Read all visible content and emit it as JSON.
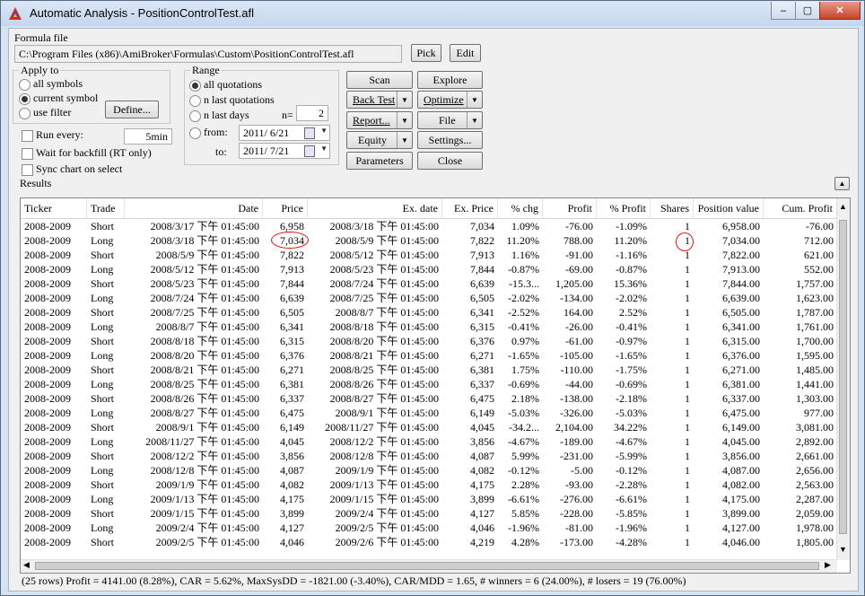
{
  "window": {
    "title": "Automatic Analysis - PositionControlTest.afl",
    "minimize": "–",
    "restore": "▢",
    "close": "✕"
  },
  "formula": {
    "label": "Formula file",
    "path": "C:\\Program Files (x86)\\AmiBroker\\Formulas\\Custom\\PositionControlTest.afl",
    "pick": "Pick",
    "edit": "Edit"
  },
  "apply_to": {
    "label": "Apply to",
    "options": [
      "all symbols",
      "current symbol",
      "use filter"
    ],
    "selected": "current symbol",
    "define": "Define..."
  },
  "range": {
    "label": "Range",
    "options": [
      "all quotations",
      "n last quotations",
      "n last days"
    ],
    "selected": "all quotations",
    "n_label": "n=",
    "n_value": "2",
    "from_label": "from:",
    "from_value": "2011/ 6/21",
    "to_label": "to:",
    "to_value": "2011/ 7/21"
  },
  "options": {
    "run_every": "Run every:",
    "run_every_value": "5min",
    "wait_backfill": "Wait for backfill (RT only)",
    "sync_chart": "Sync chart on select"
  },
  "actions": {
    "scan": "Scan",
    "explore": "Explore",
    "backtest": "Back Test",
    "optimize": "Optimize",
    "report": "Report...",
    "file": "File",
    "equity": "Equity",
    "settings": "Settings...",
    "parameters": "Parameters",
    "close": "Close"
  },
  "results": {
    "label": "Results",
    "collapse": "▲",
    "columns": [
      "Ticker",
      "Trade",
      "Date",
      "Price",
      "Ex. date",
      "Ex. Price",
      "% chg",
      "Profit",
      "% Profit",
      "Shares",
      "Position value",
      "Cum. Profit"
    ],
    "rows": [
      [
        "2008-2009",
        "Short",
        "2008/3/17 下午 01:45:00",
        "6,958",
        "2008/3/18 下午 01:45:00",
        "7,034",
        "1.09%",
        "-76.00",
        "-1.09%",
        "1",
        "6,958.00",
        "-76.00"
      ],
      [
        "2008-2009",
        "Long",
        "2008/3/18 下午 01:45:00",
        "7,034",
        "2008/5/9 下午 01:45:00",
        "7,822",
        "11.20%",
        "788.00",
        "11.20%",
        "1",
        "7,034.00",
        "712.00"
      ],
      [
        "2008-2009",
        "Short",
        "2008/5/9 下午 01:45:00",
        "7,822",
        "2008/5/12 下午 01:45:00",
        "7,913",
        "1.16%",
        "-91.00",
        "-1.16%",
        "1",
        "7,822.00",
        "621.00"
      ],
      [
        "2008-2009",
        "Long",
        "2008/5/12 下午 01:45:00",
        "7,913",
        "2008/5/23 下午 01:45:00",
        "7,844",
        "-0.87%",
        "-69.00",
        "-0.87%",
        "1",
        "7,913.00",
        "552.00"
      ],
      [
        "2008-2009",
        "Short",
        "2008/5/23 下午 01:45:00",
        "7,844",
        "2008/7/24 下午 01:45:00",
        "6,639",
        "-15.3...",
        "1,205.00",
        "15.36%",
        "1",
        "7,844.00",
        "1,757.00"
      ],
      [
        "2008-2009",
        "Long",
        "2008/7/24 下午 01:45:00",
        "6,639",
        "2008/7/25 下午 01:45:00",
        "6,505",
        "-2.02%",
        "-134.00",
        "-2.02%",
        "1",
        "6,639.00",
        "1,623.00"
      ],
      [
        "2008-2009",
        "Short",
        "2008/7/25 下午 01:45:00",
        "6,505",
        "2008/8/7 下午 01:45:00",
        "6,341",
        "-2.52%",
        "164.00",
        "2.52%",
        "1",
        "6,505.00",
        "1,787.00"
      ],
      [
        "2008-2009",
        "Long",
        "2008/8/7 下午 01:45:00",
        "6,341",
        "2008/8/18 下午 01:45:00",
        "6,315",
        "-0.41%",
        "-26.00",
        "-0.41%",
        "1",
        "6,341.00",
        "1,761.00"
      ],
      [
        "2008-2009",
        "Short",
        "2008/8/18 下午 01:45:00",
        "6,315",
        "2008/8/20 下午 01:45:00",
        "6,376",
        "0.97%",
        "-61.00",
        "-0.97%",
        "1",
        "6,315.00",
        "1,700.00"
      ],
      [
        "2008-2009",
        "Long",
        "2008/8/20 下午 01:45:00",
        "6,376",
        "2008/8/21 下午 01:45:00",
        "6,271",
        "-1.65%",
        "-105.00",
        "-1.65%",
        "1",
        "6,376.00",
        "1,595.00"
      ],
      [
        "2008-2009",
        "Short",
        "2008/8/21 下午 01:45:00",
        "6,271",
        "2008/8/25 下午 01:45:00",
        "6,381",
        "1.75%",
        "-110.00",
        "-1.75%",
        "1",
        "6,271.00",
        "1,485.00"
      ],
      [
        "2008-2009",
        "Long",
        "2008/8/25 下午 01:45:00",
        "6,381",
        "2008/8/26 下午 01:45:00",
        "6,337",
        "-0.69%",
        "-44.00",
        "-0.69%",
        "1",
        "6,381.00",
        "1,441.00"
      ],
      [
        "2008-2009",
        "Short",
        "2008/8/26 下午 01:45:00",
        "6,337",
        "2008/8/27 下午 01:45:00",
        "6,475",
        "2.18%",
        "-138.00",
        "-2.18%",
        "1",
        "6,337.00",
        "1,303.00"
      ],
      [
        "2008-2009",
        "Long",
        "2008/8/27 下午 01:45:00",
        "6,475",
        "2008/9/1 下午 01:45:00",
        "6,149",
        "-5.03%",
        "-326.00",
        "-5.03%",
        "1",
        "6,475.00",
        "977.00"
      ],
      [
        "2008-2009",
        "Short",
        "2008/9/1 下午 01:45:00",
        "6,149",
        "2008/11/27 下午 01:45:00",
        "4,045",
        "-34.2...",
        "2,104.00",
        "34.22%",
        "1",
        "6,149.00",
        "3,081.00"
      ],
      [
        "2008-2009",
        "Long",
        "2008/11/27 下午 01:45:00",
        "4,045",
        "2008/12/2 下午 01:45:00",
        "3,856",
        "-4.67%",
        "-189.00",
        "-4.67%",
        "1",
        "4,045.00",
        "2,892.00"
      ],
      [
        "2008-2009",
        "Short",
        "2008/12/2 下午 01:45:00",
        "3,856",
        "2008/12/8 下午 01:45:00",
        "4,087",
        "5.99%",
        "-231.00",
        "-5.99%",
        "1",
        "3,856.00",
        "2,661.00"
      ],
      [
        "2008-2009",
        "Long",
        "2008/12/8 下午 01:45:00",
        "4,087",
        "2009/1/9 下午 01:45:00",
        "4,082",
        "-0.12%",
        "-5.00",
        "-0.12%",
        "1",
        "4,087.00",
        "2,656.00"
      ],
      [
        "2008-2009",
        "Short",
        "2009/1/9 下午 01:45:00",
        "4,082",
        "2009/1/13 下午 01:45:00",
        "4,175",
        "2.28%",
        "-93.00",
        "-2.28%",
        "1",
        "4,082.00",
        "2,563.00"
      ],
      [
        "2008-2009",
        "Long",
        "2009/1/13 下午 01:45:00",
        "4,175",
        "2009/1/15 下午 01:45:00",
        "3,899",
        "-6.61%",
        "-276.00",
        "-6.61%",
        "1",
        "4,175.00",
        "2,287.00"
      ],
      [
        "2008-2009",
        "Short",
        "2009/1/15 下午 01:45:00",
        "3,899",
        "2009/2/4 下午 01:45:00",
        "4,127",
        "5.85%",
        "-228.00",
        "-5.85%",
        "1",
        "3,899.00",
        "2,059.00"
      ],
      [
        "2008-2009",
        "Long",
        "2009/2/4 下午 01:45:00",
        "4,127",
        "2009/2/5 下午 01:45:00",
        "4,046",
        "-1.96%",
        "-81.00",
        "-1.96%",
        "1",
        "4,127.00",
        "1,978.00"
      ],
      [
        "2008-2009",
        "Short",
        "2009/2/5 下午 01:45:00",
        "4,046",
        "2009/2/6 下午 01:45:00",
        "4,219",
        "4.28%",
        "-173.00",
        "-4.28%",
        "1",
        "4,046.00",
        "1,805.00"
      ]
    ],
    "status": "(25 rows) Profit = 4141.00 (8.28%), CAR = 5.62%, MaxSysDD = -1821.00 (-3.40%), CAR/MDD = 1.65, # winners = 6 (24.00%), # losers = 19 (76.00%)"
  },
  "colors": {
    "window_frame": "#d6e3f3",
    "panel": "#f0f0f0",
    "annotation": "#e01010"
  }
}
